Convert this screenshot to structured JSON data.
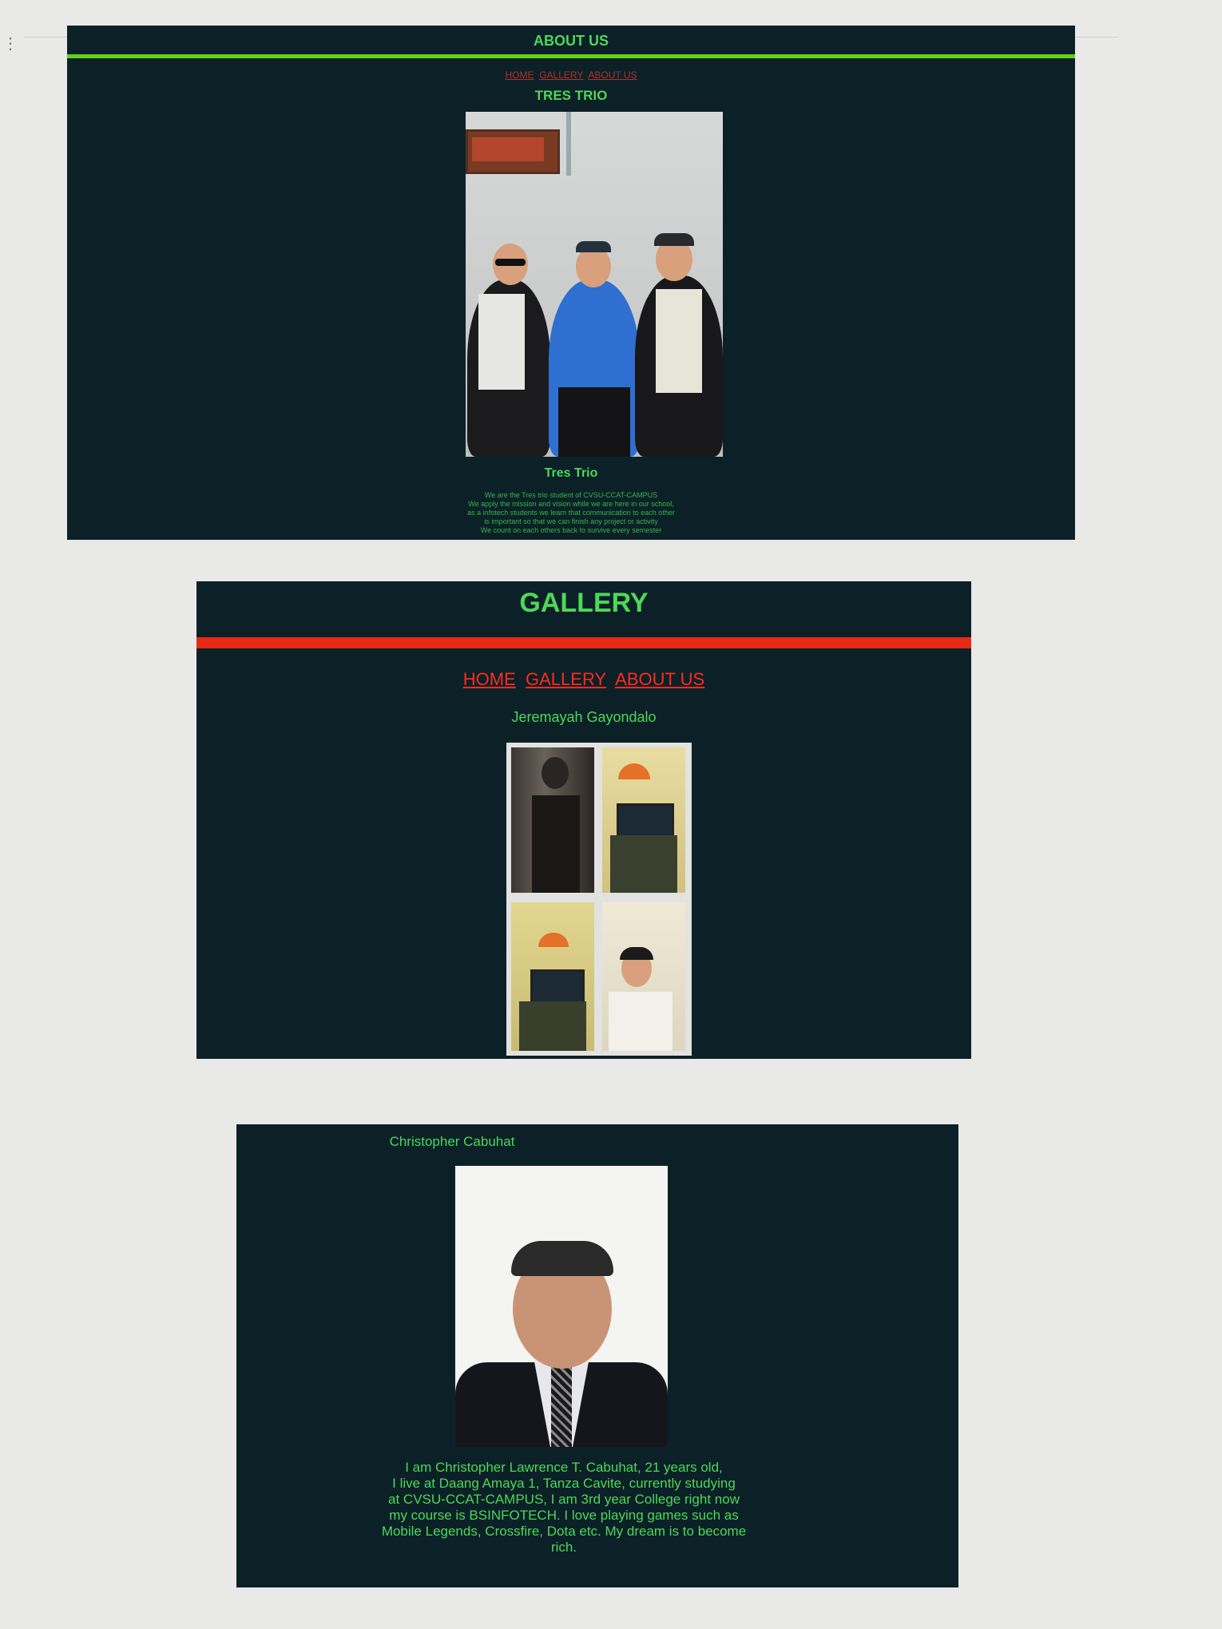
{
  "about": {
    "header": "ABOUT US",
    "nav": [
      "HOME",
      "GALLERY",
      "ABOUT US"
    ],
    "group_title": "TRES TRIO",
    "caption": "Tres Trio",
    "paragraph": [
      "We are the Tres trio student of CVSU-CCAT-CAMPUS",
      "We apply the mission and vision while we are here in our school,",
      "as a infotech students we learn that communication to each other",
      "is important so that we can finish any project or activity",
      "We count on each others back to survive every semester"
    ]
  },
  "gallery": {
    "header": "GALLERY",
    "nav": [
      "HOME",
      "GALLERY",
      "ABOUT US"
    ],
    "name": "Jeremayah Gayondalo"
  },
  "profile": {
    "name": "Christopher Cabuhat",
    "bio": [
      "I am Christopher Lawrence T. Cabuhat, 21 years old,",
      "I live at Daang Amaya 1, Tanza Cavite, currently studying",
      "at CVSU-CCAT-CAMPUS, I am 3rd year College right now",
      "my course is BSINFOTECH. I love playing games such as",
      "Mobile Legends, Crossfire, Dota etc. My dream is to become",
      "rich."
    ]
  },
  "colors": {
    "panel_bg": "#0b2127",
    "accent_green": "#4fd65a",
    "accent_red": "#ff2a1f",
    "link_red": "#ff2a1f"
  },
  "icons": [
    "kebab-menu-icon"
  ]
}
